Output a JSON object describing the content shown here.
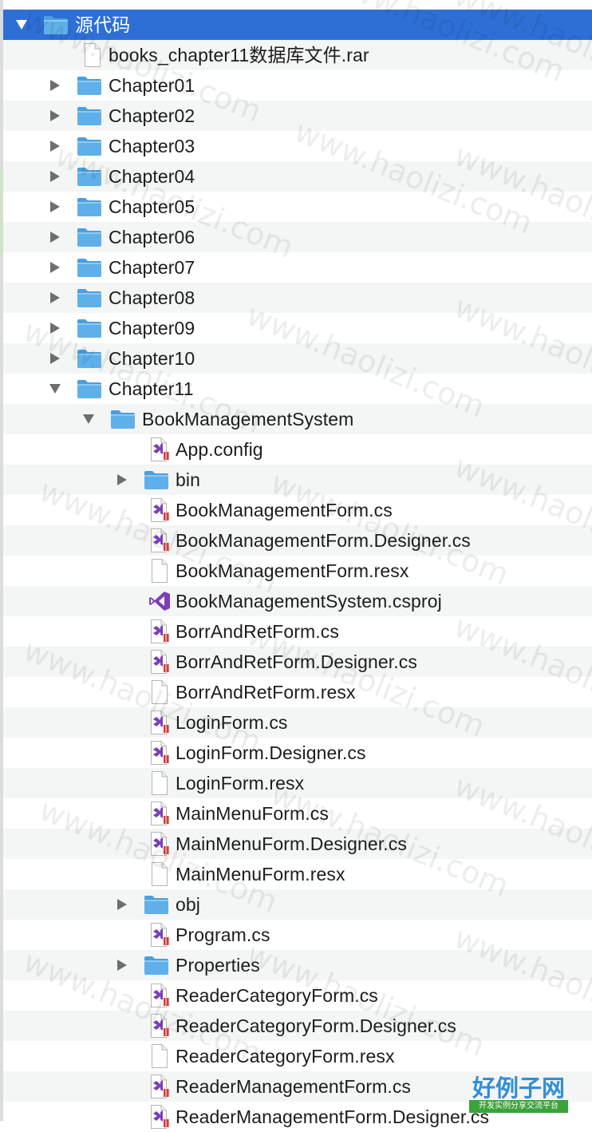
{
  "root": {
    "label": "源代码",
    "expanded": true
  },
  "root_items": [
    {
      "label": "books_chapter11数据库文件.rar",
      "type": "file"
    },
    {
      "label": "Chapter01",
      "type": "folder",
      "expanded": false
    },
    {
      "label": "Chapter02",
      "type": "folder",
      "expanded": false
    },
    {
      "label": "Chapter03",
      "type": "folder",
      "expanded": false
    },
    {
      "label": "Chapter04",
      "type": "folder",
      "expanded": false
    },
    {
      "label": "Chapter05",
      "type": "folder",
      "expanded": false
    },
    {
      "label": "Chapter06",
      "type": "folder",
      "expanded": false
    },
    {
      "label": "Chapter07",
      "type": "folder",
      "expanded": false
    },
    {
      "label": "Chapter08",
      "type": "folder",
      "expanded": false
    },
    {
      "label": "Chapter09",
      "type": "folder",
      "expanded": false
    },
    {
      "label": "Chapter10",
      "type": "folder",
      "expanded": false
    },
    {
      "label": "Chapter11",
      "type": "folder",
      "expanded": true
    }
  ],
  "project_folder": {
    "label": "BookManagementSystem",
    "expanded": true
  },
  "project_items": [
    {
      "label": "App.config",
      "type": "vs-file"
    },
    {
      "label": "bin",
      "type": "folder",
      "expanded": false
    },
    {
      "label": "BookManagementForm.cs",
      "type": "vs-file"
    },
    {
      "label": "BookManagementForm.Designer.cs",
      "type": "vs-file"
    },
    {
      "label": "BookManagementForm.resx",
      "type": "file"
    },
    {
      "label": "BookManagementSystem.csproj",
      "type": "vs-project"
    },
    {
      "label": "BorrAndRetForm.cs",
      "type": "vs-file"
    },
    {
      "label": "BorrAndRetForm.Designer.cs",
      "type": "vs-file"
    },
    {
      "label": "BorrAndRetForm.resx",
      "type": "file"
    },
    {
      "label": "LoginForm.cs",
      "type": "vs-file"
    },
    {
      "label": "LoginForm.Designer.cs",
      "type": "vs-file"
    },
    {
      "label": "LoginForm.resx",
      "type": "file"
    },
    {
      "label": "MainMenuForm.cs",
      "type": "vs-file"
    },
    {
      "label": "MainMenuForm.Designer.cs",
      "type": "vs-file"
    },
    {
      "label": "MainMenuForm.resx",
      "type": "file"
    },
    {
      "label": "obj",
      "type": "folder",
      "expanded": false
    },
    {
      "label": "Program.cs",
      "type": "vs-file"
    },
    {
      "label": "Properties",
      "type": "folder",
      "expanded": false
    },
    {
      "label": "ReaderCategoryForm.cs",
      "type": "vs-file"
    },
    {
      "label": "ReaderCategoryForm.Designer.cs",
      "type": "vs-file"
    },
    {
      "label": "ReaderCategoryForm.resx",
      "type": "file"
    },
    {
      "label": "ReaderManagementForm.cs",
      "type": "vs-file"
    },
    {
      "label": "ReaderManagementForm.Designer.cs",
      "type": "vs-file"
    }
  ],
  "watermark": "www.haolizi.com",
  "logo": {
    "title": "好例子网",
    "subtitle": "开发实例分享交流平台"
  },
  "colors": {
    "selection": "#2e6fd6",
    "folder": "#5fb0ea",
    "vs_purple": "#7b3fb6",
    "vs_red": "#d83a3a",
    "stripe": "#f4f5f5"
  },
  "icons": {
    "folder": "folder-icon",
    "file": "document-icon",
    "vs-file": "visual-studio-file-icon",
    "vs-project": "visual-studio-project-icon"
  }
}
